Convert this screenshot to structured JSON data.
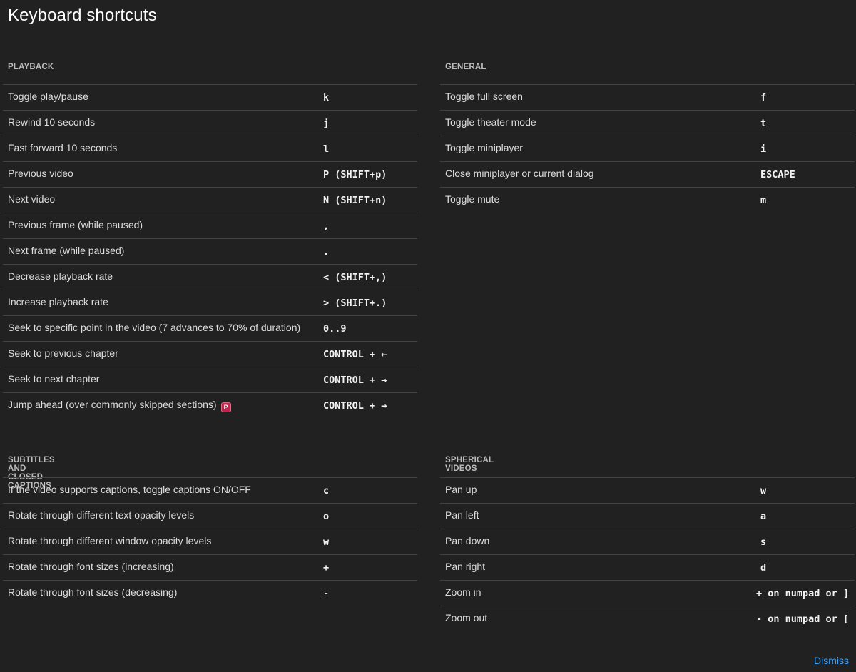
{
  "title": "Keyboard shortcuts",
  "dismiss_label": "Dismiss",
  "premium_badge": "P",
  "colors": {
    "background": "#212121",
    "divider": "#424242",
    "link": "#3ea6ff",
    "premium_badge": "#c0254e"
  },
  "sections": {
    "playback": {
      "header": "PLAYBACK",
      "rows": [
        {
          "desc": "Toggle play/pause",
          "key": "k"
        },
        {
          "desc": "Rewind 10 seconds",
          "key": "j"
        },
        {
          "desc": "Fast forward 10 seconds",
          "key": "l"
        },
        {
          "desc": "Previous video",
          "key": "P (SHIFT+p)"
        },
        {
          "desc": "Next video",
          "key": "N (SHIFT+n)"
        },
        {
          "desc": "Previous frame (while paused)",
          "key": ","
        },
        {
          "desc": "Next frame (while paused)",
          "key": "."
        },
        {
          "desc": "Decrease playback rate",
          "key": "< (SHIFT+,)"
        },
        {
          "desc": "Increase playback rate",
          "key": "> (SHIFT+.)"
        },
        {
          "desc": "Seek to specific point in the video (7 advances to 70% of duration)",
          "key": "0..9"
        },
        {
          "desc": "Seek to previous chapter",
          "key": "CONTROL + ←"
        },
        {
          "desc": "Seek to next chapter",
          "key": "CONTROL + →"
        },
        {
          "desc": "Jump ahead (over commonly skipped sections)",
          "key": "CONTROL + →"
        }
      ]
    },
    "general": {
      "header": "GENERAL",
      "rows": [
        {
          "desc": "Toggle full screen",
          "key": "f"
        },
        {
          "desc": "Toggle theater mode",
          "key": "t"
        },
        {
          "desc": "Toggle miniplayer",
          "key": "i"
        },
        {
          "desc": "Close miniplayer or current dialog",
          "key": "ESCAPE"
        },
        {
          "desc": "Toggle mute",
          "key": "m"
        }
      ]
    },
    "captions": {
      "header": "SUBTITLES AND CLOSED CAPTIONS",
      "rows": [
        {
          "desc": "If the video supports captions, toggle captions ON/OFF",
          "key": "c"
        },
        {
          "desc": "Rotate through different text opacity levels",
          "key": "o"
        },
        {
          "desc": "Rotate through different window opacity levels",
          "key": "w"
        },
        {
          "desc": "Rotate through font sizes (increasing)",
          "key": "+"
        },
        {
          "desc": "Rotate through font sizes (decreasing)",
          "key": "-"
        }
      ]
    },
    "spherical": {
      "header": "SPHERICAL VIDEOS",
      "rows": [
        {
          "desc": "Pan up",
          "key": "w"
        },
        {
          "desc": "Pan left",
          "key": "a"
        },
        {
          "desc": "Pan down",
          "key": "s"
        },
        {
          "desc": "Pan right",
          "key": "d"
        },
        {
          "desc": "Zoom in",
          "key": "+ on numpad or ]"
        },
        {
          "desc": "Zoom out",
          "key": "- on numpad or ["
        }
      ]
    }
  }
}
